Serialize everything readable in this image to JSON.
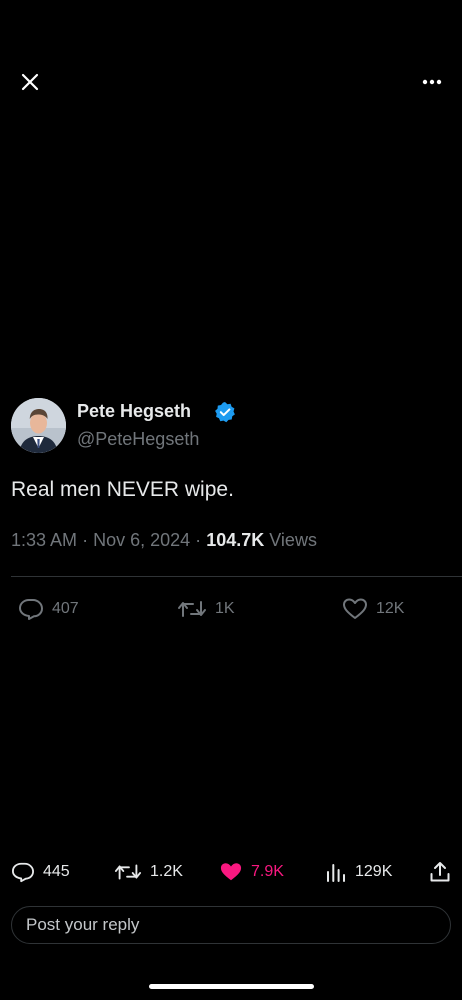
{
  "header": {
    "close_icon": "close-icon",
    "more_icon": "more-horizontal-icon"
  },
  "tweet": {
    "author_name": "Pete Hegseth",
    "author_handle": "@PeteHegseth",
    "verified_icon": "verified-badge-icon",
    "text": "Real men NEVER wipe.",
    "time": "1:33 AM",
    "separator": "·",
    "date": "Nov 6, 2024",
    "views_count": "104.7K",
    "views_label": "Views"
  },
  "inner_stats": {
    "replies": "407",
    "retweets": "1K",
    "likes": "12K"
  },
  "bottom_bar": {
    "replies": "445",
    "retweets": "1.2K",
    "likes": "7.9K",
    "views": "129K",
    "like_color": "#f91880",
    "share_icon": "share-icon"
  },
  "reply": {
    "placeholder": "Post your reply"
  },
  "colors": {
    "background": "#000000",
    "primary_text": "#e7e9ea",
    "secondary_text": "#71767b",
    "verified_blue": "#1d9bf0",
    "like_pink": "#f91880"
  }
}
